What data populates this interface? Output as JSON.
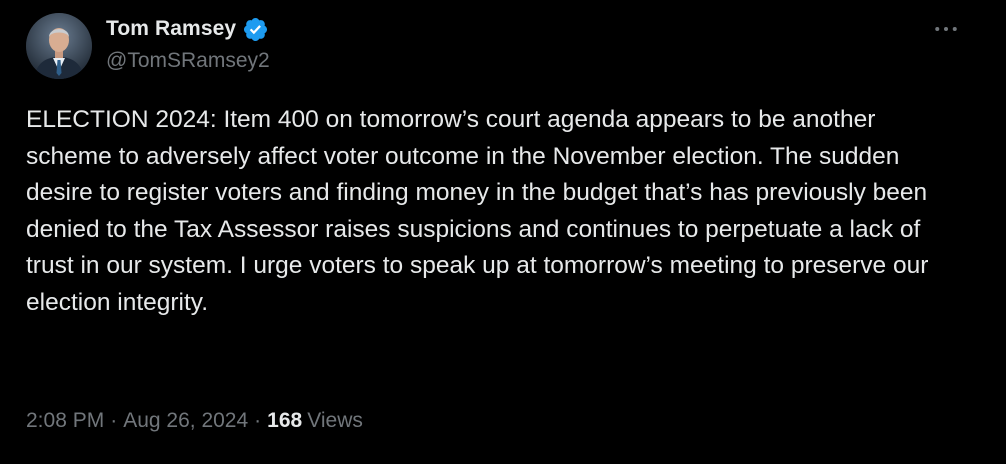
{
  "author": {
    "display_name": "Tom Ramsey",
    "handle": "@TomSRamsey2",
    "verified": true,
    "verified_color": "#1d9bf0"
  },
  "post": {
    "text": "ELECTION 2024: Item 400 on tomorrow’s court agenda appears to be another scheme to adversely affect voter outcome in the November election. The sudden desire to register voters and finding money in the budget that’s has previously been denied to the Tax Assessor raises suspicions and continues to perpetuate a lack of trust in our system. I urge voters to speak up at tomorrow’s meeting to preserve our election integrity.",
    "time": "2:08 PM",
    "date": "Aug 26, 2024",
    "separator": "·",
    "views_count": "168",
    "views_label": "Views"
  },
  "icons": {
    "more": "more-horizontal-icon",
    "verified": "verified-badge-icon",
    "avatar": "profile-photo"
  },
  "colors": {
    "background": "#000000",
    "text_primary": "#e7e9ea",
    "text_secondary": "#71767b"
  }
}
